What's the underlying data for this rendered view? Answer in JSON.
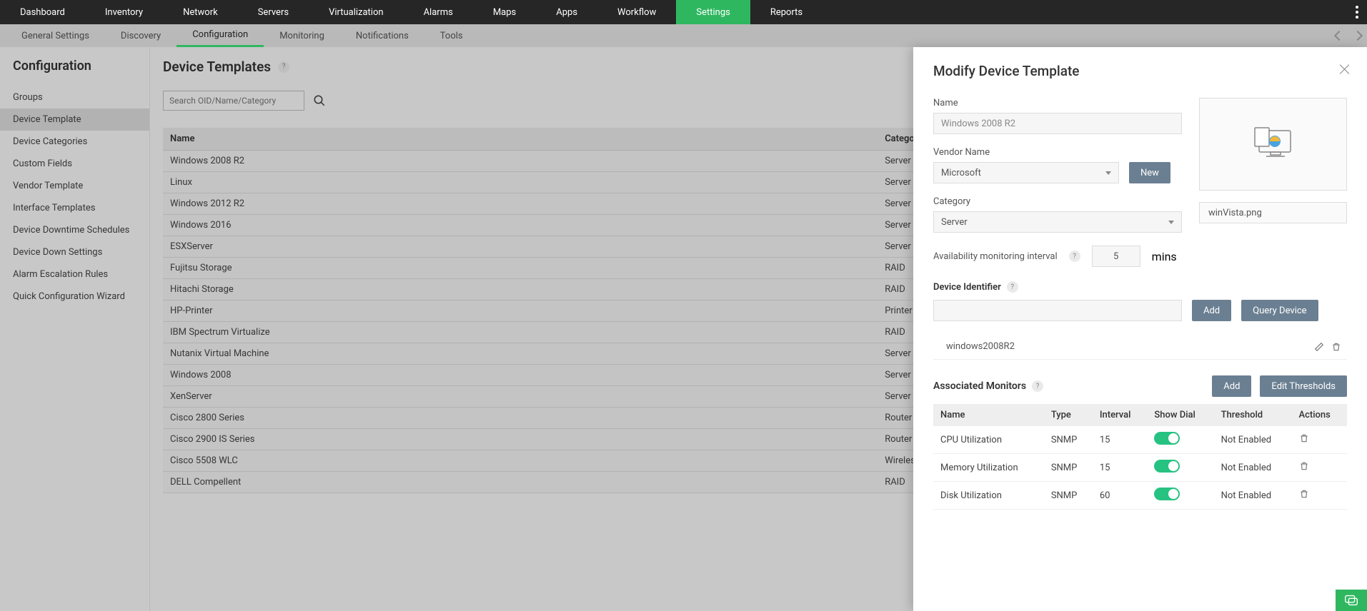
{
  "topnav": {
    "items": [
      {
        "label": "Dashboard"
      },
      {
        "label": "Inventory"
      },
      {
        "label": "Network"
      },
      {
        "label": "Servers"
      },
      {
        "label": "Virtualization"
      },
      {
        "label": "Alarms"
      },
      {
        "label": "Maps"
      },
      {
        "label": "Apps"
      },
      {
        "label": "Workflow"
      },
      {
        "label": "Settings",
        "active": true
      },
      {
        "label": "Reports"
      }
    ]
  },
  "subnav": {
    "items": [
      {
        "label": "General Settings"
      },
      {
        "label": "Discovery"
      },
      {
        "label": "Configuration",
        "active": true
      },
      {
        "label": "Monitoring"
      },
      {
        "label": "Notifications"
      },
      {
        "label": "Tools"
      }
    ]
  },
  "sidebar": {
    "heading": "Configuration",
    "items": [
      {
        "label": "Groups"
      },
      {
        "label": "Device Template",
        "active": true
      },
      {
        "label": "Device Categories"
      },
      {
        "label": "Custom Fields"
      },
      {
        "label": "Vendor Template"
      },
      {
        "label": "Interface Templates"
      },
      {
        "label": "Device Downtime Schedules"
      },
      {
        "label": "Device Down Settings"
      },
      {
        "label": "Alarm Escalation Rules"
      },
      {
        "label": "Quick Configuration Wizard"
      }
    ]
  },
  "page": {
    "title": "Device Templates",
    "search_placeholder": "Search OID/Name/Category"
  },
  "table": {
    "col_name": "Name",
    "col_category": "Category",
    "rows": [
      {
        "name": "Windows 2008 R2",
        "category": "Server"
      },
      {
        "name": "Linux",
        "category": "Server"
      },
      {
        "name": "Windows 2012 R2",
        "category": "Server"
      },
      {
        "name": "Windows 2016",
        "category": "Server"
      },
      {
        "name": "ESXServer",
        "category": "Server"
      },
      {
        "name": "Fujitsu Storage",
        "category": "RAID"
      },
      {
        "name": "Hitachi Storage",
        "category": "RAID"
      },
      {
        "name": "HP-Printer",
        "category": "Printer"
      },
      {
        "name": "IBM Spectrum Virtualize",
        "category": "RAID"
      },
      {
        "name": "Nutanix Virtual Machine",
        "category": "Server"
      },
      {
        "name": "Windows 2008",
        "category": "Server"
      },
      {
        "name": "XenServer",
        "category": "Server"
      },
      {
        "name": "Cisco 2800 Series",
        "category": "Router"
      },
      {
        "name": "Cisco 2900 IS Series",
        "category": "Router"
      },
      {
        "name": "Cisco 5508 WLC",
        "category": "Wireless LAN Controller"
      },
      {
        "name": "DELL Compellent",
        "category": "RAID"
      }
    ]
  },
  "panel": {
    "title": "Modify Device Template",
    "name_label": "Name",
    "name_value": "Windows 2008 R2",
    "vendor_label": "Vendor Name",
    "vendor_value": "Microsoft",
    "vendor_new_btn": "New",
    "category_label": "Category",
    "category_value": "Server",
    "avail_label": "Availability monitoring interval",
    "avail_value": "5",
    "avail_unit": "mins",
    "image_name": "winVista.png",
    "device_id_label": "Device Identifier",
    "device_id_add_btn": "Add",
    "device_id_query_btn": "Query Device",
    "identifiers": [
      {
        "value": "windows2008R2"
      }
    ],
    "assoc_monitors_label": "Associated Monitors",
    "assoc_add_btn": "Add",
    "assoc_edit_btn": "Edit Thresholds",
    "monitors": {
      "col_name": "Name",
      "col_type": "Type",
      "col_interval": "Interval",
      "col_show_dial": "Show Dial",
      "col_threshold": "Threshold",
      "col_actions": "Actions",
      "rows": [
        {
          "name": "CPU Utilization",
          "type": "SNMP",
          "interval": "15",
          "threshold": "Not Enabled"
        },
        {
          "name": "Memory Utilization",
          "type": "SNMP",
          "interval": "15",
          "threshold": "Not Enabled"
        },
        {
          "name": "Disk Utilization",
          "type": "SNMP",
          "interval": "60",
          "threshold": "Not Enabled"
        }
      ]
    }
  }
}
